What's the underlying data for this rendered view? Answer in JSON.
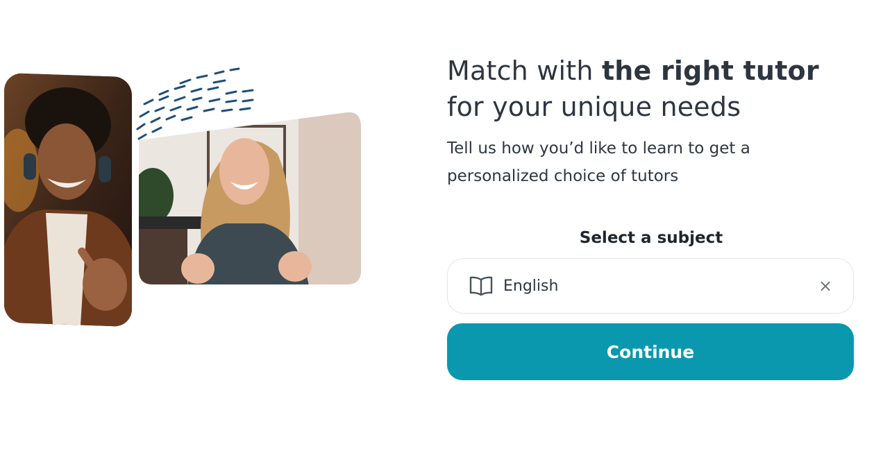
{
  "hero": {
    "dashes_color": "#1d4e7a",
    "left_photo_alt": "smiling man with headphones pointing at himself",
    "right_photo_alt": "laughing woman in grey sweater"
  },
  "intro": {
    "headline_pre": "Match with ",
    "headline_bold": "the right tutor",
    "headline_post": " for your unique needs",
    "subline": "Tell us how you’d like to learn to get a personalized choice of tutors"
  },
  "subject": {
    "label": "Select a subject",
    "icon": "book-icon",
    "value": "English",
    "clear_icon": "×"
  },
  "actions": {
    "continue_label": "Continue",
    "accent": "#0a98ae"
  }
}
